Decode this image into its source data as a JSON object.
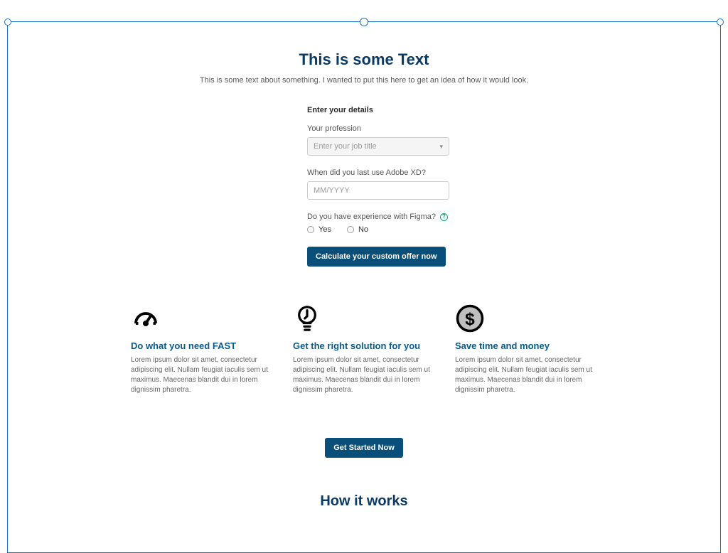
{
  "hero": {
    "title": "This is some Text",
    "subtitle": "This is some text about something. I wanted to put this here to get an idea of how it would look."
  },
  "form": {
    "heading": "Enter your details",
    "profession": {
      "label": "Your profession",
      "placeholder": "Enter your job title"
    },
    "last_used": {
      "label": "When did you last use Adobe XD?",
      "placeholder": "MM/YYYY"
    },
    "figma": {
      "label": "Do you have experience with Figma?",
      "option_yes": "Yes",
      "option_no": "No"
    },
    "submit": "Calculate your custom offer now"
  },
  "features": [
    {
      "title": "Do what you need FAST",
      "body": "Lorem ipsum dolor sit amet, consectetur adipiscing elit. Nullam feugiat iaculis sem ut maximus. Maecenas blandit dui in lorem dignissim pharetra."
    },
    {
      "title": "Get the right solution for you",
      "body": "Lorem ipsum dolor sit amet, consectetur adipiscing elit. Nullam feugiat iaculis sem ut maximus. Maecenas blandit dui in lorem dignissim pharetra."
    },
    {
      "title": "Save time and money",
      "body": "Lorem ipsum dolor sit amet, consectetur adipiscing elit. Nullam feugiat iaculis sem ut maximus. Maecenas blandit dui in lorem dignissim pharetra."
    }
  ],
  "cta": "Get Started Now",
  "how_it_works": "How it works"
}
